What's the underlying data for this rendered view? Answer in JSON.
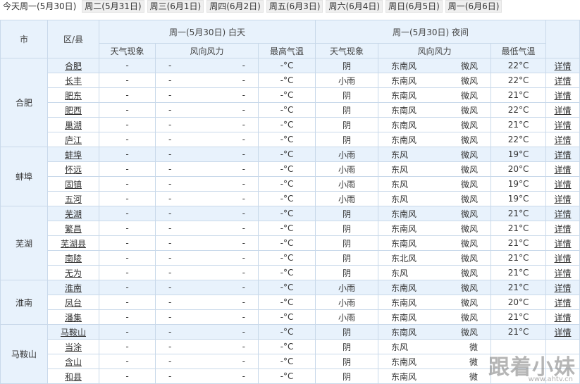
{
  "tabs": [
    "今天周一(5月30日)",
    "周二(5月31日)",
    "周三(6月1日)",
    "周四(6月2日)",
    "周五(6月3日)",
    "周六(6月4日)",
    "周日(6月5日)",
    "周一(6月6日)"
  ],
  "header": {
    "city": "市",
    "district": "区/县",
    "day_group": "周一(5月30日) 白天",
    "night_group": "周一(5月30日) 夜间",
    "day_weather": "天气现象",
    "day_wind": "风向风力",
    "max_temp": "最高气温",
    "night_weather": "天气现象",
    "night_wind": "风向风力",
    "min_temp": "最低气温"
  },
  "groups": [
    {
      "city": "合肥",
      "rows": [
        {
          "district": "合肥",
          "dw": "-",
          "dwd": "-",
          "dwp": "-",
          "tmax": "-°C",
          "nw": "阴",
          "nwd": "东南风",
          "nwp": "微风",
          "tmin": "22°C",
          "detail": "详情"
        },
        {
          "district": "长丰",
          "dw": "-",
          "dwd": "-",
          "dwp": "-",
          "tmax": "-°C",
          "nw": "小雨",
          "nwd": "东南风",
          "nwp": "微风",
          "tmin": "22°C",
          "detail": "详情"
        },
        {
          "district": "肥东",
          "dw": "-",
          "dwd": "-",
          "dwp": "-",
          "tmax": "-°C",
          "nw": "阴",
          "nwd": "东南风",
          "nwp": "微风",
          "tmin": "21°C",
          "detail": "详情"
        },
        {
          "district": "肥西",
          "dw": "-",
          "dwd": "-",
          "dwp": "-",
          "tmax": "-°C",
          "nw": "阴",
          "nwd": "东南风",
          "nwp": "微风",
          "tmin": "22°C",
          "detail": "详情"
        },
        {
          "district": "巢湖",
          "dw": "-",
          "dwd": "-",
          "dwp": "-",
          "tmax": "-°C",
          "nw": "阴",
          "nwd": "东南风",
          "nwp": "微风",
          "tmin": "21°C",
          "detail": "详情"
        },
        {
          "district": "庐江",
          "dw": "-",
          "dwd": "-",
          "dwp": "-",
          "tmax": "-°C",
          "nw": "阴",
          "nwd": "东南风",
          "nwp": "微风",
          "tmin": "22°C",
          "detail": "详情"
        }
      ]
    },
    {
      "city": "蚌埠",
      "rows": [
        {
          "district": "蚌埠",
          "dw": "-",
          "dwd": "-",
          "dwp": "-",
          "tmax": "-°C",
          "nw": "小雨",
          "nwd": "东风",
          "nwp": "微风",
          "tmin": "19°C",
          "detail": "详情"
        },
        {
          "district": "怀远",
          "dw": "-",
          "dwd": "-",
          "dwp": "-",
          "tmax": "-°C",
          "nw": "小雨",
          "nwd": "东风",
          "nwp": "微风",
          "tmin": "20°C",
          "detail": "详情"
        },
        {
          "district": "固镇",
          "dw": "-",
          "dwd": "-",
          "dwp": "-",
          "tmax": "-°C",
          "nw": "小雨",
          "nwd": "东风",
          "nwp": "微风",
          "tmin": "19°C",
          "detail": "详情"
        },
        {
          "district": "五河",
          "dw": "-",
          "dwd": "-",
          "dwp": "-",
          "tmax": "-°C",
          "nw": "小雨",
          "nwd": "东风",
          "nwp": "微风",
          "tmin": "19°C",
          "detail": "详情"
        }
      ]
    },
    {
      "city": "芜湖",
      "rows": [
        {
          "district": "芜湖",
          "dw": "-",
          "dwd": "-",
          "dwp": "-",
          "tmax": "-°C",
          "nw": "阴",
          "nwd": "东南风",
          "nwp": "微风",
          "tmin": "21°C",
          "detail": "详情"
        },
        {
          "district": "繁昌",
          "dw": "-",
          "dwd": "-",
          "dwp": "-",
          "tmax": "-°C",
          "nw": "阴",
          "nwd": "东南风",
          "nwp": "微风",
          "tmin": "21°C",
          "detail": "详情"
        },
        {
          "district": "芜湖县",
          "dw": "-",
          "dwd": "-",
          "dwp": "-",
          "tmax": "-°C",
          "nw": "阴",
          "nwd": "东南风",
          "nwp": "微风",
          "tmin": "21°C",
          "detail": "详情"
        },
        {
          "district": "南陵",
          "dw": "-",
          "dwd": "-",
          "dwp": "-",
          "tmax": "-°C",
          "nw": "阴",
          "nwd": "东北风",
          "nwp": "微风",
          "tmin": "21°C",
          "detail": "详情"
        },
        {
          "district": "无为",
          "dw": "-",
          "dwd": "-",
          "dwp": "-",
          "tmax": "-°C",
          "nw": "阴",
          "nwd": "东风",
          "nwp": "微风",
          "tmin": "21°C",
          "detail": "详情"
        }
      ]
    },
    {
      "city": "淮南",
      "rows": [
        {
          "district": "淮南",
          "dw": "-",
          "dwd": "-",
          "dwp": "-",
          "tmax": "-°C",
          "nw": "小雨",
          "nwd": "东南风",
          "nwp": "微风",
          "tmin": "21°C",
          "detail": "详情"
        },
        {
          "district": "凤台",
          "dw": "-",
          "dwd": "-",
          "dwp": "-",
          "tmax": "-°C",
          "nw": "小雨",
          "nwd": "东南风",
          "nwp": "微风",
          "tmin": "20°C",
          "detail": "详情"
        },
        {
          "district": "潘集",
          "dw": "-",
          "dwd": "-",
          "dwp": "-",
          "tmax": "-°C",
          "nw": "小雨",
          "nwd": "东南风",
          "nwp": "微风",
          "tmin": "21°C",
          "detail": "详情"
        }
      ]
    },
    {
      "city": "马鞍山",
      "rows": [
        {
          "district": "马鞍山",
          "dw": "-",
          "dwd": "-",
          "dwp": "-",
          "tmax": "-°C",
          "nw": "阴",
          "nwd": "东南风",
          "nwp": "微风",
          "tmin": "21°C",
          "detail": "详情"
        },
        {
          "district": "当涂",
          "dw": "-",
          "dwd": "-",
          "dwp": "-",
          "tmax": "-°C",
          "nw": "阴",
          "nwd": "东风",
          "nwp": "微",
          "tmin": "",
          "detail": ""
        },
        {
          "district": "含山",
          "dw": "-",
          "dwd": "-",
          "dwp": "-",
          "tmax": "-°C",
          "nw": "阴",
          "nwd": "东南风",
          "nwp": "微",
          "tmin": "",
          "detail": ""
        },
        {
          "district": "和县",
          "dw": "-",
          "dwd": "-",
          "dwp": "-",
          "tmax": "-°C",
          "nw": "阴",
          "nwd": "东南风",
          "nwp": "微",
          "tmin": "",
          "detail": ""
        }
      ]
    }
  ],
  "watermark": {
    "text": "跟着小妹",
    "url": "www.ahtv.cn"
  }
}
